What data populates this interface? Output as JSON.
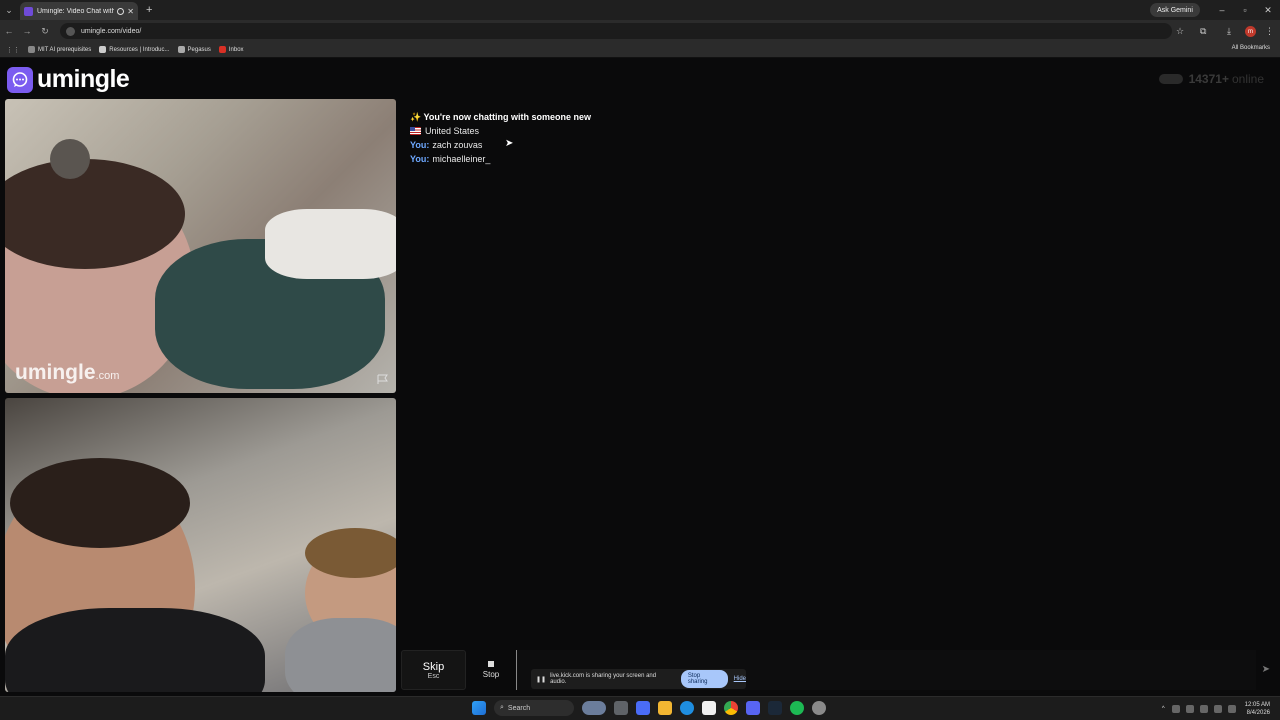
{
  "browser": {
    "tab_title": "Umingle: Video Chat with S",
    "tab_close": "✕",
    "new_tab": "+",
    "ask_gemini": "Ask Gemini",
    "url": "umingle.com/video/",
    "bookmarks": [
      {
        "label": "MIT AI prerequisites",
        "color": "#888888"
      },
      {
        "label": "Resources | Introduc...",
        "color": "#cccccc"
      },
      {
        "label": "Pegasus",
        "color": "#aaaaaa"
      },
      {
        "label": "Inbox",
        "color": "#d93025"
      }
    ],
    "all_bookmarks": "All Bookmarks",
    "profile_initial": "m"
  },
  "site": {
    "logo_text": "umingle",
    "online_count": "14371+",
    "online_word": "online",
    "watermark_main": "umingle",
    "watermark_suffix": ".com",
    "accent": "#7b5cf0"
  },
  "chat": {
    "new_chat": "✨ You're now chatting with someone new",
    "country": "United States",
    "messages": [
      {
        "sender": "You:",
        "text": "zach zouvas"
      },
      {
        "sender": "You:",
        "text": "michaelleiner_"
      }
    ]
  },
  "controls": {
    "skip_label": "Skip",
    "skip_key": "Esc",
    "stop_label": "Stop",
    "input_value": ""
  },
  "share_banner": {
    "text": "live.kick.com is sharing your screen and audio.",
    "stop_sharing": "Stop sharing",
    "hide": "Hide"
  },
  "taskbar": {
    "search": "Search",
    "time": "12:05 AM",
    "date": "8/4/2026"
  }
}
